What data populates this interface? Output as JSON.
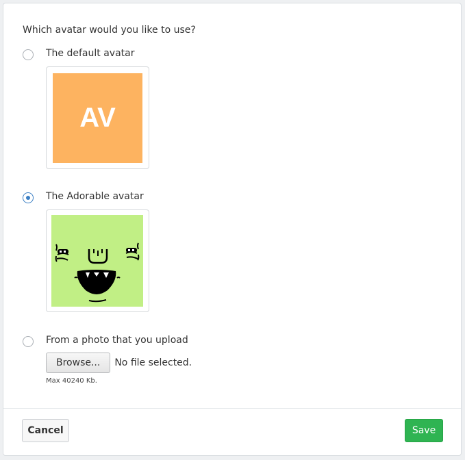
{
  "question": "Which avatar would you like to use?",
  "options": [
    {
      "label": "The default avatar",
      "checked": false
    },
    {
      "label": "The Adorable avatar",
      "checked": true
    },
    {
      "label": "From a photo that you upload",
      "checked": false
    }
  ],
  "default_avatar": {
    "initials": "AV",
    "background": "#fdb360"
  },
  "adorable_avatar": {
    "background": "#c1ef85"
  },
  "upload": {
    "browse_label": "Browse...",
    "file_status": "No file selected.",
    "max_note": "Max 40240 Kb."
  },
  "footer": {
    "cancel_label": "Cancel",
    "save_label": "Save"
  },
  "colors": {
    "accent": "#3b7fc4",
    "save": "#2fb452"
  }
}
